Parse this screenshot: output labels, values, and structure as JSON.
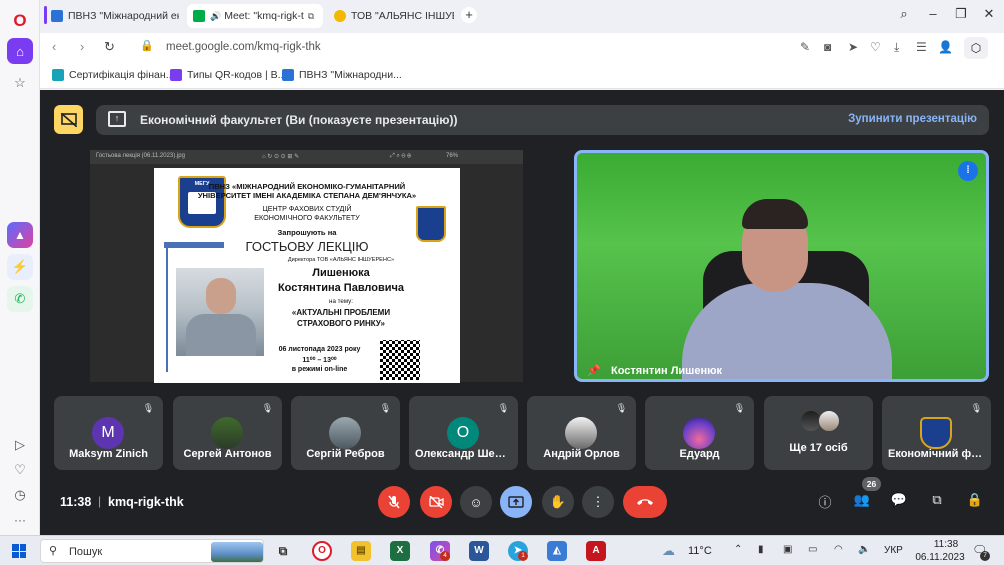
{
  "browser": {
    "tabs": [
      {
        "label": "ПВНЗ \"Міжнародний ек",
        "favicon_color": "#2a72d6"
      },
      {
        "label": "Meet: \"kmq-rigk-t",
        "favicon_color": "#00ac47"
      },
      {
        "label": "ТОВ \"АЛЬЯНС ІНШУЕРЕН",
        "favicon_color": "#f2b900"
      }
    ],
    "url": "meet.google.com/kmq-rigk-thk",
    "bookmarks": [
      {
        "label": "Сертифікація фінан..."
      },
      {
        "label": "Типы QR-кодов | В..."
      },
      {
        "label": "ПВНЗ \"Міжнародни..."
      }
    ]
  },
  "meet": {
    "presentation_banner": "Економічний факультет (Ви (показуєте презентацію))",
    "stop_presenting": "Зупинити презентацію",
    "slide": {
      "toolbar_file": "Гостьова лекція (06.11.2023).jpg",
      "toolbar_zoom": "76%",
      "logo_label": "МЕГУ",
      "org_line1": "ПВНЗ «МІЖНАРОДНИЙ ЕКОНОМІКО-ГУМАНІТАРНИЙ",
      "org_line2": "УНІВЕРСИТЕТ ІМЕНІ АКАДЕМІКА СТЕПАНА ДЕМ'ЯНЧУКА»",
      "center_line1": "ЦЕНТР ФАХОВИХ СТУДІЙ",
      "center_line2": "ЕКОНОМІЧНОГО ФАКУЛЬТЕТУ",
      "invite": "Запрошують на",
      "event": "ГОСТЬОВУ ЛЕКЦІЮ",
      "director": "Директора ТОВ «АЛЬЯНС ІНШУЕРЕНС»",
      "surname": "Лишенюка",
      "name": "Костянтина Павловича",
      "on_topic": "на тему:",
      "topic_line1": "«АКТУАЛЬНІ ПРОБЛЕМИ",
      "topic_line2": "СТРАХОВОГО РИНКУ»",
      "date": "06 листопада 2023 року",
      "time": "11⁰⁰ – 13⁰⁰",
      "mode": "в режимі on-line"
    },
    "speaker_name": "Костянтин Лишенюк",
    "participants": [
      {
        "name": "Maksym Zinich",
        "initial": "M",
        "avatar_color": "#5e35b1"
      },
      {
        "name": "Сергей Антонов",
        "initial": "",
        "avatar_color": "#4a6b3a"
      },
      {
        "name": "Сергій Ребров",
        "initial": "",
        "avatar_color": "#6b7a86"
      },
      {
        "name": "Олександр Шевченко",
        "initial": "О",
        "avatar_color": "#00897b"
      },
      {
        "name": "Андрій Орлов",
        "initial": "",
        "avatar_color": "#e8e8e8"
      },
      {
        "name": "Едуард",
        "initial": "",
        "avatar_color": "#6a3fc8"
      },
      {
        "name": "Економічний факультет",
        "initial": "",
        "avatar_color": "#1b3f8f"
      }
    ],
    "more_label": "Ще 17 осіб",
    "time": "11:38",
    "separator": "|",
    "meeting_code": "kmq-rigk-thk",
    "people_count": "26"
  },
  "taskbar": {
    "search_label": "Пошук",
    "mail_badge": "4",
    "telegram_badge": "1",
    "weather": "11°C",
    "language": "УКР",
    "time": "11:38",
    "date": "06.11.2023",
    "notifications_badge": "7"
  }
}
